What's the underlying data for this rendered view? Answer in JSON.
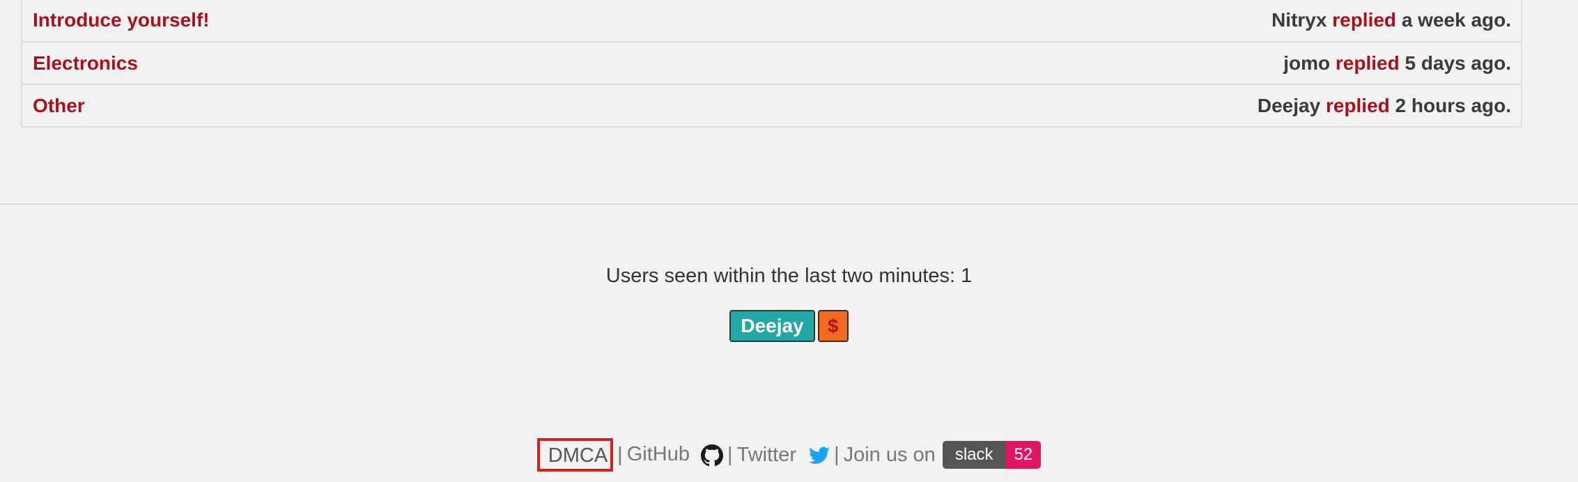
{
  "topics": [
    {
      "title": "Introduce yourself!",
      "user": "Nitryx",
      "action": "replied",
      "time": "a week ago."
    },
    {
      "title": "Electronics",
      "user": "jomo",
      "action": "replied",
      "time": "5 days ago."
    },
    {
      "title": "Other",
      "user": "Deejay",
      "action": "replied",
      "time": "2 hours ago."
    }
  ],
  "online": {
    "text": "Users seen within the last two minutes: 1",
    "users": [
      {
        "name": "Deejay",
        "donor_symbol": "$"
      }
    ]
  },
  "footer": {
    "dmca": "DMCA",
    "separator": "|",
    "github": "GitHub",
    "twitter": "Twitter",
    "join": "Join us on",
    "slack_label": "slack",
    "slack_count": "52"
  },
  "colors": {
    "link_red": "#a8101e",
    "user_teal": "#22a6a6",
    "donor_orange": "#f26a21",
    "slack_gray": "#555555",
    "slack_pink": "#e01563",
    "twitter_blue": "#1da1f2"
  },
  "icons": {
    "github": "github-icon",
    "twitter": "twitter-icon"
  }
}
